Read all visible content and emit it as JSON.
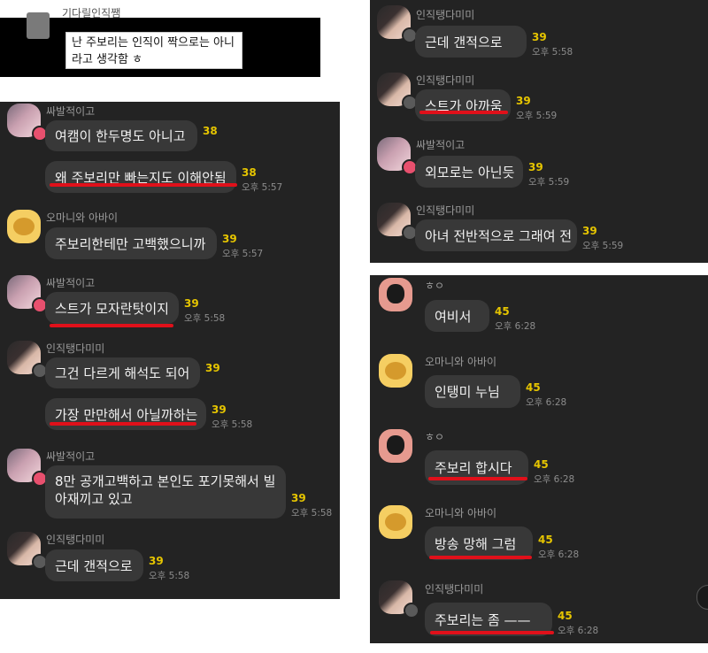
{
  "top_comment": {
    "author": "기다릴인직쨈",
    "text": "난 주보리는 인직이 짝으로는 아니라고 생각함 ㅎ"
  },
  "left_panel": [
    {
      "sender": "싸발적이고",
      "bubbles": [
        {
          "text": "여캠이 한두명도 아니고",
          "count": "38",
          "time": ""
        },
        {
          "text": "왜 주보리만 빠는지도 이해안됨",
          "count": "38",
          "time": "오후 5:57"
        }
      ]
    },
    {
      "sender": "오마니와 아바이",
      "bubbles": [
        {
          "text": "주보리한테만 고백했으니까",
          "count": "39",
          "time": "오후 5:57"
        }
      ]
    },
    {
      "sender": "싸발적이고",
      "bubbles": [
        {
          "text": "스트가 모자란탓이지",
          "count": "39",
          "time": "오후 5:58"
        }
      ]
    },
    {
      "sender": "인직탱다미미",
      "bubbles": [
        {
          "text": "그건 다르게 해석도 되어",
          "count": "39",
          "time": ""
        },
        {
          "text": "가장 만만해서 아닐까하는",
          "count": "39",
          "time": "오후 5:58"
        }
      ]
    },
    {
      "sender": "싸발적이고",
      "bubbles": [
        {
          "text": "8만 공개고백하고 본인도 포기못해서 빌 아재끼고 있고",
          "count": "39",
          "time": "오후 5:58"
        }
      ]
    },
    {
      "sender": "인직탱다미미",
      "bubbles": [
        {
          "text": "근데 갠적으로",
          "count": "39",
          "time": "오후 5:58"
        }
      ]
    }
  ],
  "right_top_panel": [
    {
      "sender": "인직탱다미미",
      "bubbles": [
        {
          "text": "근데 갠적으로",
          "count": "39",
          "time": "오후 5:58"
        }
      ]
    },
    {
      "sender": "인직탱다미미",
      "bubbles": [
        {
          "text": "스트가 아까움",
          "count": "39",
          "time": "오후 5:59"
        }
      ]
    },
    {
      "sender": "싸발적이고",
      "bubbles": [
        {
          "text": "외모로는 아닌듯",
          "count": "39",
          "time": "오후 5:59"
        }
      ]
    },
    {
      "sender": "인직탱다미미",
      "bubbles": [
        {
          "text": "아녀 전반적으로 그래여 전",
          "count": "39",
          "time": "오후 5:59"
        }
      ]
    }
  ],
  "right_bottom_panel": [
    {
      "sender": "ㅎㅇ",
      "bubbles": [
        {
          "text": "여비서",
          "count": "45",
          "time": "오후 6:28"
        }
      ]
    },
    {
      "sender": "오마니와 아바이",
      "bubbles": [
        {
          "text": "인탱미 누님",
          "count": "45",
          "time": "오후 6:28"
        }
      ]
    },
    {
      "sender": "ㅎㅇ",
      "bubbles": [
        {
          "text": "주보리 합시다",
          "count": "45",
          "time": "오후 6:28"
        }
      ]
    },
    {
      "sender": "오마니와 아바이",
      "bubbles": [
        {
          "text": "방송 망해 그럼",
          "count": "45",
          "time": "오후 6:28"
        }
      ]
    },
    {
      "sender": "인직탱다미미",
      "bubbles": [
        {
          "text": "주보리는 좀 ——",
          "count": "45",
          "time": "오후 6:28"
        }
      ]
    }
  ],
  "colors": {
    "panel_bg": "#232323",
    "bubble_bg": "#383838",
    "unread_count": "#e6c500",
    "underline": "#e0101a"
  },
  "icons": [
    "crown-badge-icon",
    "menu-badge-icon",
    "ryan-avatar",
    "omani-avatar",
    "profile-photo"
  ]
}
